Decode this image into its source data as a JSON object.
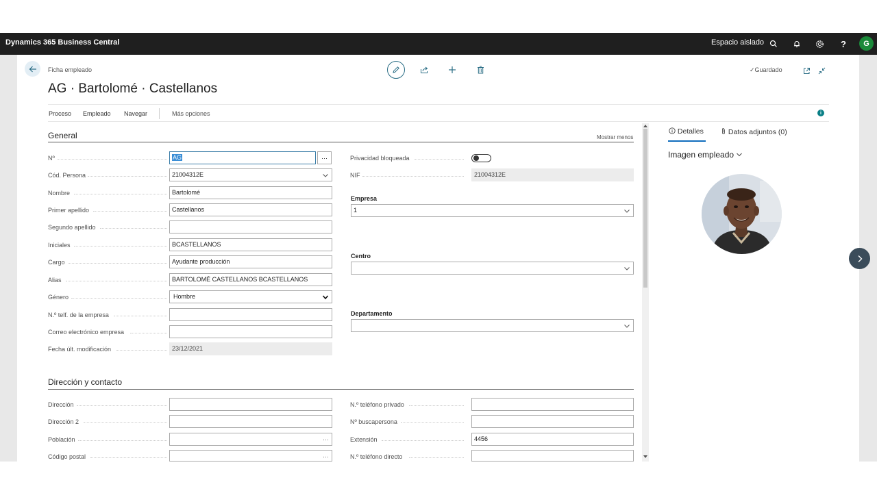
{
  "app": {
    "brand": "Dynamics 365 Business Central",
    "environment": "Espacio aislado",
    "user_initial": "G",
    "icons": [
      "search-icon",
      "bell-icon",
      "gear-icon",
      "help-icon"
    ]
  },
  "page": {
    "breadcrumb": "Ficha empleado",
    "title": "AG · Bartolomé · Castellanos",
    "saved_status": "Guardado",
    "actions": [
      "edit-icon",
      "share-icon",
      "add-icon",
      "delete-icon"
    ]
  },
  "menu": {
    "items": [
      "Proceso",
      "Empleado",
      "Navegar"
    ],
    "more": "Más opciones"
  },
  "general": {
    "title": "General",
    "show_less": "Mostrar menos",
    "fields": {
      "no_label": "Nº",
      "no_value": "AG",
      "cod_persona_label": "Cód. Persona",
      "cod_persona_value": "21004312E",
      "nombre_label": "Nombre",
      "nombre_value": "Bartolomé",
      "primer_apellido_label": "Primer apellido",
      "primer_apellido_value": "Castellanos",
      "segundo_apellido_label": "Segundo apellido",
      "segundo_apellido_value": "",
      "iniciales_label": "Iniciales",
      "iniciales_value": "BCASTELLANOS",
      "cargo_label": "Cargo",
      "cargo_value": "Ayudante producción",
      "alias_label": "Alias",
      "alias_value": "BARTOLOMÉ CASTELLANOS  BCASTELLANOS",
      "genero_label": "Género",
      "genero_value": "Hombre",
      "telf_empresa_label": "N.º telf. de la empresa",
      "telf_empresa_value": "",
      "correo_label": "Correo electrónico empresa",
      "correo_value": "",
      "fecha_label": "Fecha últ. modificación",
      "fecha_value": "23/12/2021",
      "privacidad_label": "Privacidad bloqueada",
      "privacidad_on": false,
      "nif_label": "NIF",
      "nif_value": "21004312E",
      "empresa_label": "Empresa",
      "empresa_value": "1",
      "centro_label": "Centro",
      "centro_value": "",
      "departamento_label": "Departamento",
      "departamento_value": ""
    }
  },
  "contact": {
    "title": "Dirección y contacto",
    "fields": {
      "direccion_label": "Dirección",
      "direccion_value": "",
      "direccion2_label": "Dirección 2",
      "direccion2_value": "",
      "poblacion_label": "Población",
      "poblacion_value": "",
      "cp_label": "Código postal",
      "cp_value": "",
      "tel_privado_label": "N.º teléfono privado",
      "tel_privado_value": "",
      "buscapersona_label": "Nº buscapersona",
      "buscapersona_value": "",
      "extension_label": "Extensión",
      "extension_value": "4456",
      "tel_directo_label": "N.º teléfono directo",
      "tel_directo_value": ""
    }
  },
  "side": {
    "tab_details": "Detalles",
    "tab_attachments": "Datos adjuntos (0)",
    "photo_title": "Imagen empleado"
  }
}
